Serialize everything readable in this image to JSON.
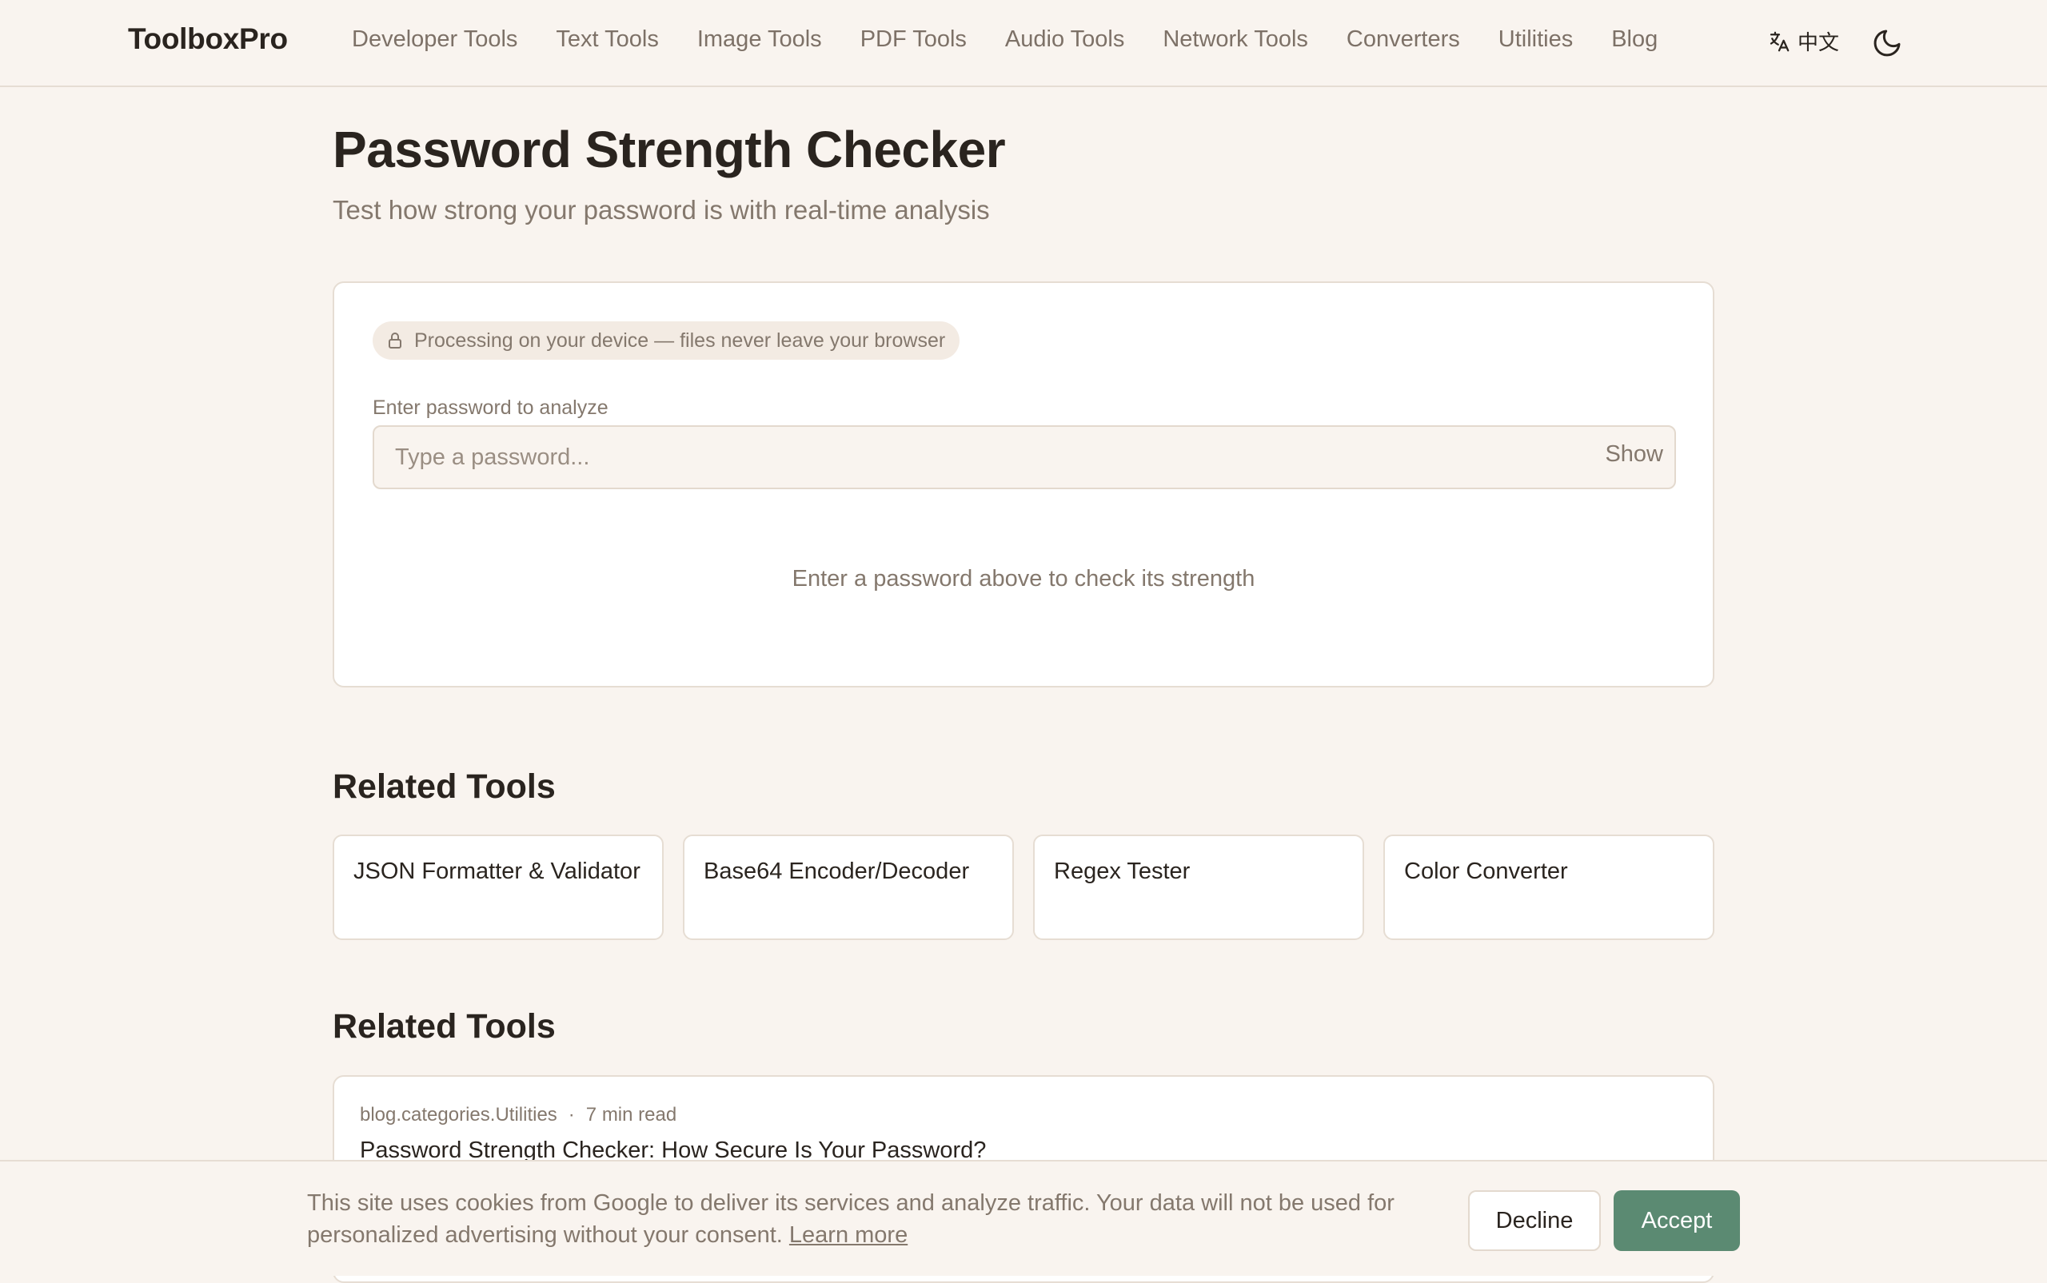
{
  "header": {
    "logo": "ToolboxPro",
    "nav": [
      "Developer Tools",
      "Text Tools",
      "Image Tools",
      "PDF Tools",
      "Audio Tools",
      "Network Tools",
      "Converters",
      "Utilities",
      "Blog"
    ],
    "language": "中文",
    "language_icon": "translate-icon",
    "theme_icon": "moon-icon"
  },
  "page": {
    "title": "Password Strength Checker",
    "subtitle": "Test how strong your password is with real-time analysis"
  },
  "checker": {
    "privacy_badge": "Processing on your device — files never leave your browser",
    "privacy_icon": "lock-icon",
    "input_label": "Enter password to analyze",
    "input_placeholder": "Type a password...",
    "input_value": "",
    "show_label": "Show",
    "empty_hint": "Enter a password above to check its strength"
  },
  "related_tools": {
    "title": "Related Tools",
    "items": [
      "JSON Formatter & Validator",
      "Base64 Encoder/Decoder",
      "Regex Tester",
      "Color Converter"
    ]
  },
  "related_posts": {
    "title": "Related Tools",
    "items": [
      {
        "category": "blog.categories.Utilities",
        "separator": "·",
        "read_time": "7 min read",
        "title": "Password Strength Checker: How Secure Is Your Password?"
      }
    ]
  },
  "cookie_banner": {
    "text": "This site uses cookies from Google to deliver its services and analyze traffic. Your data will not be used for personalized advertising without your consent.",
    "learn_more": "Learn more",
    "decline": "Decline",
    "accept": "Accept"
  },
  "colors": {
    "background": "#f9f4ef",
    "accent": "#5b8a72",
    "text": "#2a241f",
    "muted": "#84786d"
  }
}
